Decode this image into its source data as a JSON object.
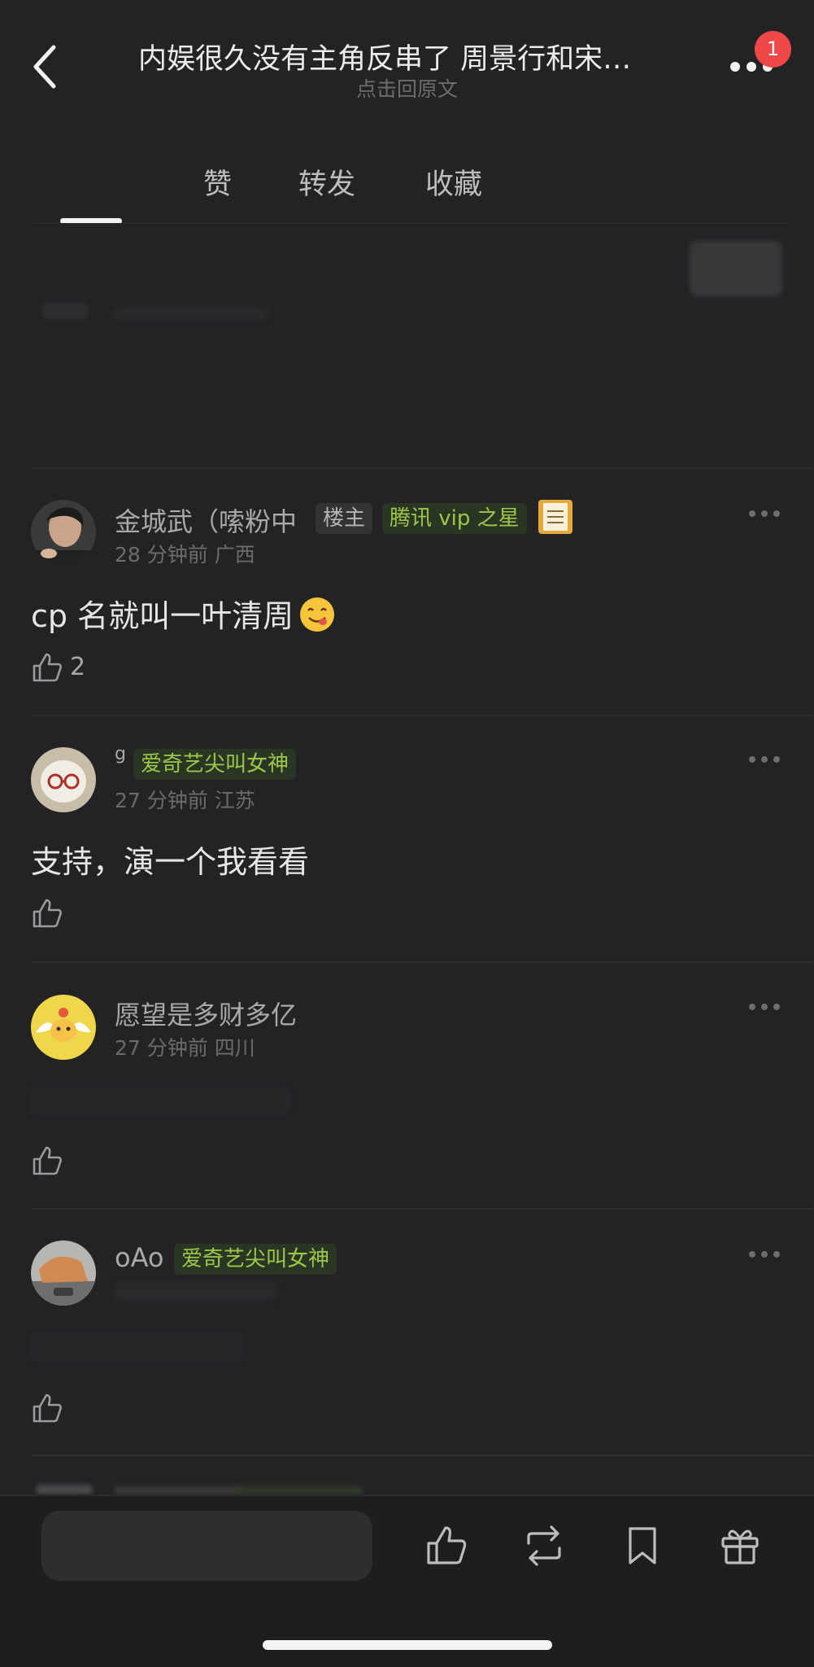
{
  "header": {
    "title": "内娱很久没有主角反串了 周景行和宋…",
    "subtitle": "点击回原文",
    "badge_count": "1"
  },
  "tabs": [
    {
      "label": "赞"
    },
    {
      "label": "转发"
    },
    {
      "label": "收藏"
    }
  ],
  "comments": [
    {
      "username": "金城武（嗦粉中",
      "badges": [
        "楼主",
        "腾讯 vip 之星"
      ],
      "time_location": "28 分钟前 广西",
      "text": "cp 名就叫一叶清周",
      "likes": "2"
    },
    {
      "username": "g",
      "badges": [
        "爱奇艺尖叫女神"
      ],
      "time_location": "27 分钟前 江苏",
      "text": "支持，演一个我看看",
      "likes": ""
    },
    {
      "username": "愿望是多财多亿",
      "badges": [],
      "time_location": "27 分钟前 四川",
      "text": "",
      "likes": ""
    },
    {
      "username": "oAo",
      "badges": [
        "爱奇艺尖叫女神"
      ],
      "time_location": "",
      "text": "",
      "likes": ""
    }
  ],
  "colors": {
    "background": "#232326",
    "badge_red": "#f04848",
    "tag_green": "#9cc84a"
  },
  "icons": [
    "back-icon",
    "more-icon",
    "thumbs-up-icon",
    "repost-icon",
    "bookmark-icon",
    "gift-icon",
    "smile-emoji-icon"
  ]
}
